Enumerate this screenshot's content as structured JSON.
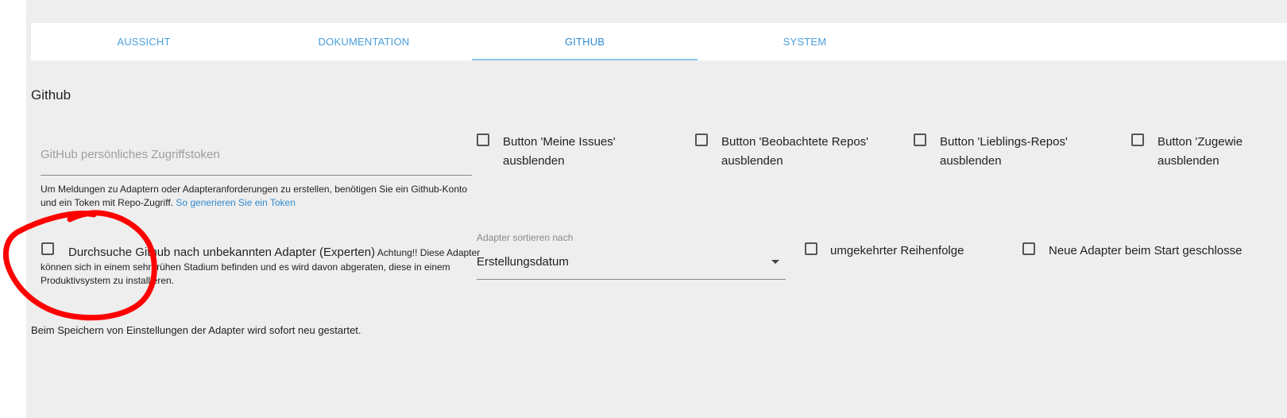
{
  "tabs": [
    {
      "label": "AUSSICHT"
    },
    {
      "label": "DOKUMENTATION"
    },
    {
      "label": "GITHUB"
    },
    {
      "label": "SYSTEM"
    }
  ],
  "section_title": "Github",
  "token": {
    "placeholder": "GitHub persönliches Zugriffstoken",
    "helper_text": "Um Meldungen zu Adaptern oder Adapteranforderungen zu erstellen, benötigen Sie ein Github-Konto und ein Token mit Repo-Zugriff.",
    "helper_link": "So generieren Sie ein Token"
  },
  "hide_buttons": [
    {
      "label_line1": "Button 'Meine Issues'",
      "label_line2": "ausblenden"
    },
    {
      "label_line1": "Button 'Beobachtete Repos'",
      "label_line2": "ausblenden"
    },
    {
      "label_line1": "Button 'Lieblings-Repos'",
      "label_line2": "ausblenden"
    },
    {
      "label_line1": "Button 'Zugewie",
      "label_line2": "ausblenden"
    }
  ],
  "experts": {
    "label": "Durchsuche Github nach unbekannten Adapter (Experten)",
    "warning": "Achtung!! Diese Adapter können sich in einem sehr frühen Stadium befinden und es wird davon abgeraten, diese in einem Produktivsystem zu installieren."
  },
  "sort": {
    "label": "Adapter sortieren nach",
    "value": "Erstellungsdatum"
  },
  "reverse_order": {
    "label": "umgekehrter Reihenfolge"
  },
  "new_adapters_closed": {
    "label": "Neue Adapter beim Start geschlosse"
  },
  "footer_note": "Beim Speichern von Einstellungen der Adapter wird sofort neu gestartet.",
  "colors": {
    "accent": "#2f8bd0",
    "background": "#eeeeee",
    "annotation": "#ff0000"
  }
}
